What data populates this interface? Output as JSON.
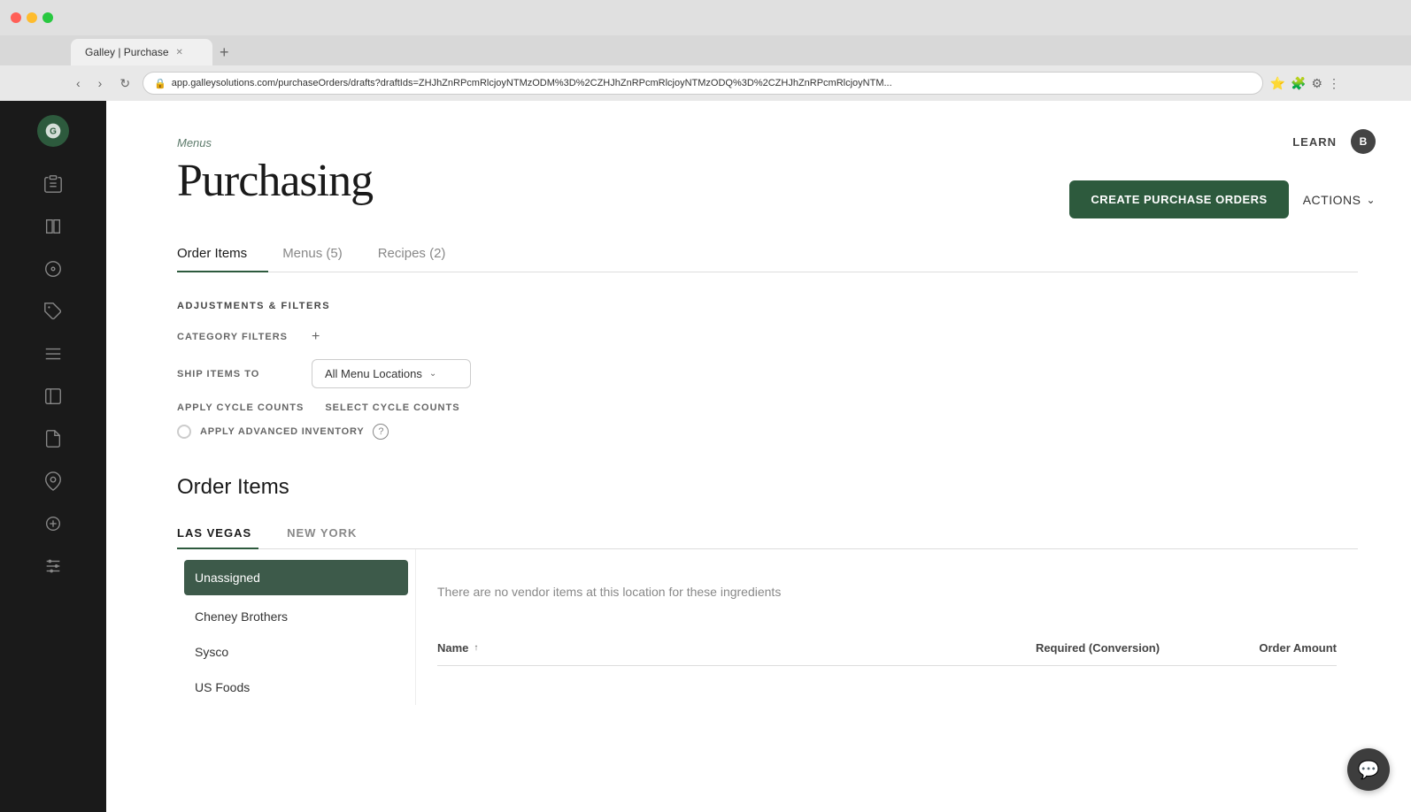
{
  "browser": {
    "tab_title": "Galley | Purchase",
    "address": "app.galleysolutions.com/purchaseOrders/drafts?draftIds=ZHJhZnRPcmRlcjoyNTMzODM%3D%2CZHJhZnRPcmRlcjoyNTMzODQ%3D%2CZHJhZnRPcmRlcjoyNTM...",
    "nav_back": "‹",
    "nav_forward": "›",
    "nav_refresh": "↻",
    "add_tab": "+"
  },
  "topbar": {
    "learn_label": "LEARN",
    "user_initial": "B"
  },
  "sidebar": {
    "items": [
      {
        "name": "clipboard-icon",
        "symbol": "📋"
      },
      {
        "name": "book-icon",
        "symbol": "📖"
      },
      {
        "name": "compass-icon",
        "symbol": "◎"
      },
      {
        "name": "tag-icon",
        "symbol": "🏷"
      },
      {
        "name": "list-icon",
        "symbol": "≡"
      },
      {
        "name": "notebook-icon",
        "symbol": "📓"
      },
      {
        "name": "report-icon",
        "symbol": "📄"
      },
      {
        "name": "location-icon",
        "symbol": "⊙"
      },
      {
        "name": "camera-icon",
        "symbol": "⊕"
      },
      {
        "name": "sliders-icon",
        "symbol": "⋮"
      }
    ]
  },
  "breadcrumb": "Menus",
  "page_title": "Purchasing",
  "header_actions": {
    "create_po_label": "CREATE PURCHASE ORDERS",
    "actions_label": "ACTIONS"
  },
  "tabs": [
    {
      "label": "Order Items",
      "active": true
    },
    {
      "label": "Menus (5)",
      "active": false
    },
    {
      "label": "Recipes (2)",
      "active": false
    }
  ],
  "filters": {
    "section_title": "ADJUSTMENTS & FILTERS",
    "category_filters_label": "CATEGORY FILTERS",
    "ship_items_to_label": "SHIP ITEMS TO",
    "ship_items_value": "All Menu Locations",
    "apply_cycle_counts_label": "APPLY CYCLE COUNTS",
    "select_cycle_counts_label": "SELECT CYCLE COUNTS",
    "apply_advanced_inventory_label": "APPLY ADVANCED INVENTORY"
  },
  "order_items": {
    "title": "Order Items",
    "location_tabs": [
      {
        "label": "LAS VEGAS",
        "active": true
      },
      {
        "label": "NEW YORK",
        "active": false
      }
    ],
    "vendors": [
      {
        "label": "Unassigned",
        "active": true
      },
      {
        "label": "Cheney Brothers",
        "active": false
      },
      {
        "label": "Sysco",
        "active": false
      },
      {
        "label": "US Foods",
        "active": false
      }
    ],
    "no_vendor_message": "There are no vendor items at this location for these ingredients",
    "table_headers": {
      "name": "Name",
      "required": "Required (Conversion)",
      "order_amount": "Order Amount"
    }
  },
  "chat": {
    "icon": "💬"
  }
}
